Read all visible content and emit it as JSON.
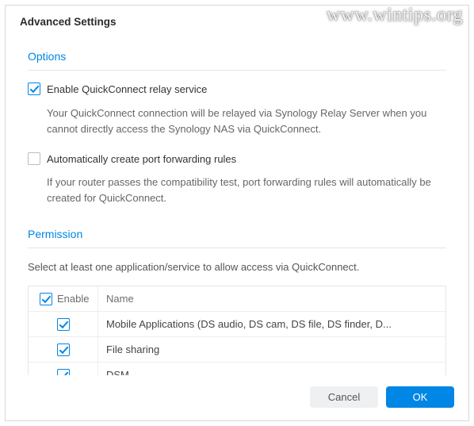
{
  "window": {
    "title": "Advanced Settings"
  },
  "watermark": "www.wintips.org",
  "options": {
    "header": "Options",
    "relay": {
      "label": "Enable QuickConnect relay service",
      "checked": true,
      "desc": "Your QuickConnect connection will be relayed via Synology Relay Server when you cannot directly access the Synology NAS via QuickConnect."
    },
    "portfw": {
      "label": "Automatically create port forwarding rules",
      "checked": false,
      "desc": "If your router passes the compatibility test, port forwarding rules will automatically be created for QuickConnect."
    }
  },
  "permission": {
    "header": "Permission",
    "intro": "Select at least one application/service to allow access via QuickConnect.",
    "columns": {
      "enable": "Enable",
      "name": "Name"
    },
    "header_checked": true,
    "rows": [
      {
        "checked": true,
        "name": "Mobile Applications (DS audio, DS cam, DS file, DS finder, D..."
      },
      {
        "checked": true,
        "name": "File sharing"
      },
      {
        "checked": true,
        "name": "DSM"
      }
    ]
  },
  "footer": {
    "cancel": "Cancel",
    "ok": "OK"
  }
}
